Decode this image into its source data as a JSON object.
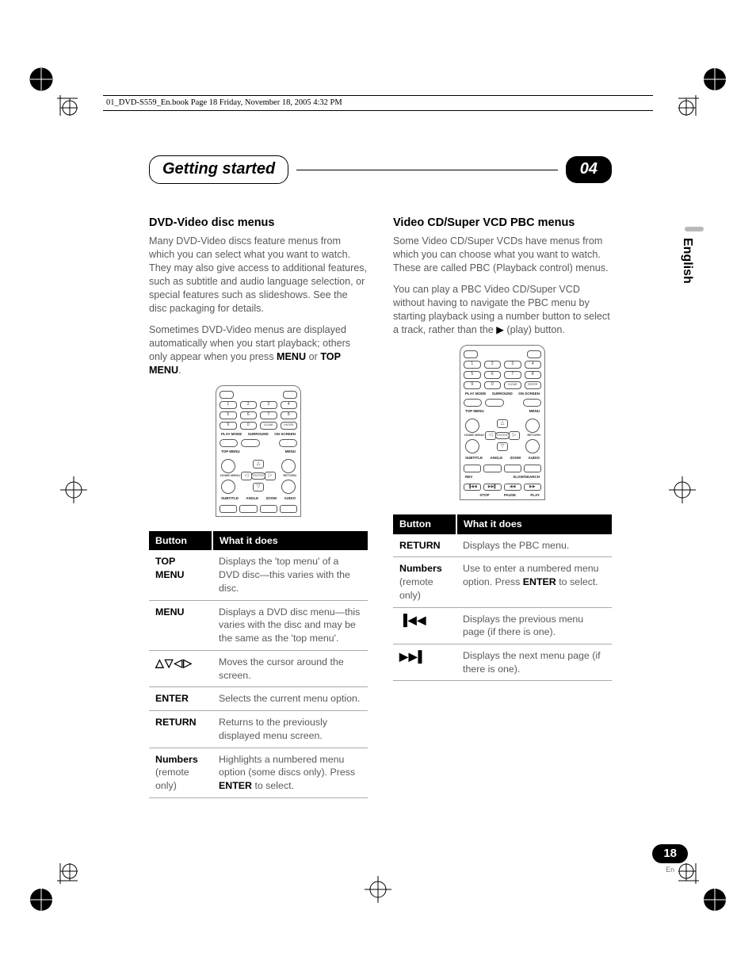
{
  "print_header": "01_DVD-S559_En.book  Page 18  Friday, November 18, 2005  4:32 PM",
  "chapter": {
    "title": "Getting started",
    "number": "04"
  },
  "language_tab": "English",
  "page_badge": {
    "number": "18",
    "locale": "En"
  },
  "col1": {
    "heading": "DVD-Video disc menus",
    "p1": "Many DVD-Video discs feature menus from which you can select what you want to watch. They may also give access to additional features, such as subtitle and audio language selection, or special features such as slideshows. See the disc packaging for details.",
    "p2_a": "Sometimes DVD-Video menus are displayed automatically when you start playback; others only appear when you press ",
    "p2_menu": "MENU",
    "p2_or": " or ",
    "p2_topmenu": "TOP MENU",
    "p2_dot": ".",
    "table": {
      "h1": "Button",
      "h2": "What it does",
      "rows": [
        {
          "b": "TOP MENU",
          "d": "Displays the 'top menu' of a DVD disc—this varies with the disc."
        },
        {
          "b": "MENU",
          "d": "Displays a DVD disc menu—this varies with the disc and may be the same as the 'top menu'."
        },
        {
          "b_glyph": "△▽◁▷",
          "d": "Moves the cursor around the screen."
        },
        {
          "b": "ENTER",
          "d": "Selects the current menu option."
        },
        {
          "b": "RETURN",
          "d": "Returns to the previously displayed menu screen."
        },
        {
          "b": "Numbers",
          "b_sub": "(remote only)",
          "d_a": "Highlights a numbered menu option (some discs only). Press ",
          "d_bold": "ENTER",
          "d_b": " to select."
        }
      ]
    }
  },
  "col2": {
    "heading": "Video CD/Super VCD PBC menus",
    "p1": "Some Video CD/Super VCDs have menus from which you can choose what you want to watch. These are called PBC (Playback control) menus.",
    "p2_a": "You can play a PBC Video CD/Super VCD without having to navigate the PBC menu by starting playback using a number button to select a track, rather than the ",
    "p2_play": "▶",
    "p2_b": " (play) button.",
    "table": {
      "h1": "Button",
      "h2": "What it does",
      "rows": [
        {
          "b": "RETURN",
          "d": "Displays the PBC menu."
        },
        {
          "b": "Numbers",
          "b_sub": "(remote only)",
          "d_a": "Use to enter a numbered menu option. Press ",
          "d_bold": "ENTER",
          "d_b": " to select."
        },
        {
          "b_glyph": "▐◀◀",
          "d": "Displays the previous menu page (if there is one)."
        },
        {
          "b_glyph": "▶▶▌",
          "d": "Displays the next menu page (if there is one)."
        }
      ]
    }
  },
  "remote": {
    "nums": [
      "1",
      "2",
      "3",
      "4",
      "5",
      "6",
      "7",
      "8",
      "9",
      "0"
    ],
    "clear": "CLEAR",
    "enter_small": "ENTER",
    "labels": {
      "playmode": "PLAY MODE",
      "surround": "SURROUND",
      "onscreen": "ON SCREEN",
      "topmenu": "TOP MENU",
      "menu": "MENU",
      "home": "HOME MENU",
      "return": "RETURN",
      "subtitle": "SUBTITLE",
      "angle": "ANGLE",
      "zoom": "ZOOM",
      "audio": "AUDIO",
      "rev": "REV",
      "slow": "SLOW/SEARCH",
      "stop": "STOP",
      "pause": "PAUSE",
      "play": "PLAY"
    }
  }
}
